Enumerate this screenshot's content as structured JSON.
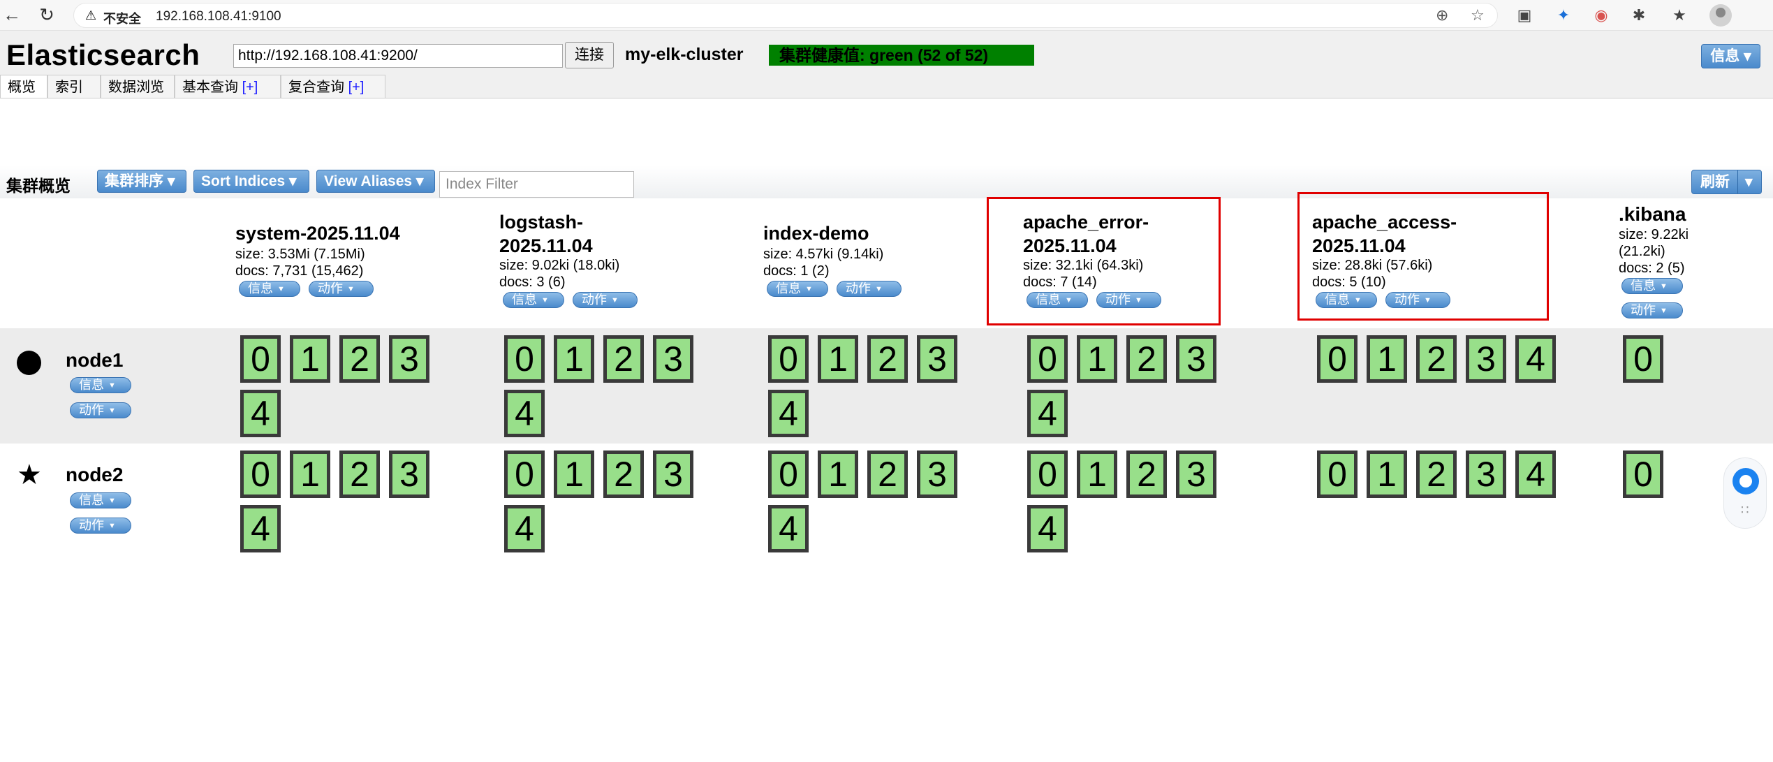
{
  "browser": {
    "insecure_label": "不安全",
    "url": "192.168.108.41:9100"
  },
  "header": {
    "app_title": "Elasticsearch",
    "connect_url": "http://192.168.108.41:9200/",
    "connect_button": "连接",
    "cluster_name": "my-elk-cluster",
    "cluster_health": "集群健康值: green (52 of 52)",
    "info_button": "信息"
  },
  "tabs": [
    {
      "label": "概览",
      "plus": ""
    },
    {
      "label": "索引",
      "plus": ""
    },
    {
      "label": "数据浏览",
      "plus": ""
    },
    {
      "label": "基本查询",
      "plus": "[+]"
    },
    {
      "label": "复合查询",
      "plus": "[+]"
    }
  ],
  "overview": {
    "title": "集群概览",
    "sort_button": "集群排序",
    "sort_indices_button": "Sort Indices",
    "view_aliases_button": "View Aliases",
    "index_filter_placeholder": "Index Filter",
    "refresh_button": "刷新"
  },
  "pill_labels": {
    "info": "信息",
    "action": "动作"
  },
  "indices": [
    {
      "name_line1": "system-2025.11.04",
      "name_line2": "",
      "size": "size: 3.53Mi (7.15Mi)",
      "docs": "docs: 7,731 (15,462)",
      "shards": [
        "0",
        "1",
        "2",
        "3",
        "4"
      ],
      "highlighted": false
    },
    {
      "name_line1": "logstash-",
      "name_line2": "2025.11.04",
      "size": "size: 9.02ki (18.0ki)",
      "docs": "docs: 3 (6)",
      "shards": [
        "0",
        "1",
        "2",
        "3",
        "4"
      ],
      "highlighted": false
    },
    {
      "name_line1": "index-demo",
      "name_line2": "",
      "size": "size: 4.57ki (9.14ki)",
      "docs": "docs: 1 (2)",
      "shards": [
        "0",
        "1",
        "2",
        "3",
        "4"
      ],
      "highlighted": false
    },
    {
      "name_line1": "apache_error-",
      "name_line2": "2025.11.04",
      "size": "size: 32.1ki (64.3ki)",
      "docs": "docs: 7 (14)",
      "shards": [
        "0",
        "1",
        "2",
        "3",
        "4"
      ],
      "highlighted": true
    },
    {
      "name_line1": "apache_access-",
      "name_line2": "2025.11.04",
      "size": "size: 28.8ki (57.6ki)",
      "docs": "docs: 5 (10)",
      "shards": [
        "0",
        "1",
        "2",
        "3",
        "4"
      ],
      "highlighted": true
    },
    {
      "name_line1": ".kibana",
      "name_line2": "",
      "size": "size: 9.22ki",
      "size2": "(21.2ki)",
      "docs": "docs: 2 (5)",
      "shards": [
        "0"
      ],
      "highlighted": false
    }
  ],
  "nodes": [
    {
      "name": "node1",
      "marker": "circle"
    },
    {
      "name": "node2",
      "marker": "star"
    }
  ],
  "colors": {
    "health_green": "#008000",
    "shard_fill": "#98df8a",
    "button_blue": "#4a8acc",
    "highlight_red": "#e00000"
  }
}
